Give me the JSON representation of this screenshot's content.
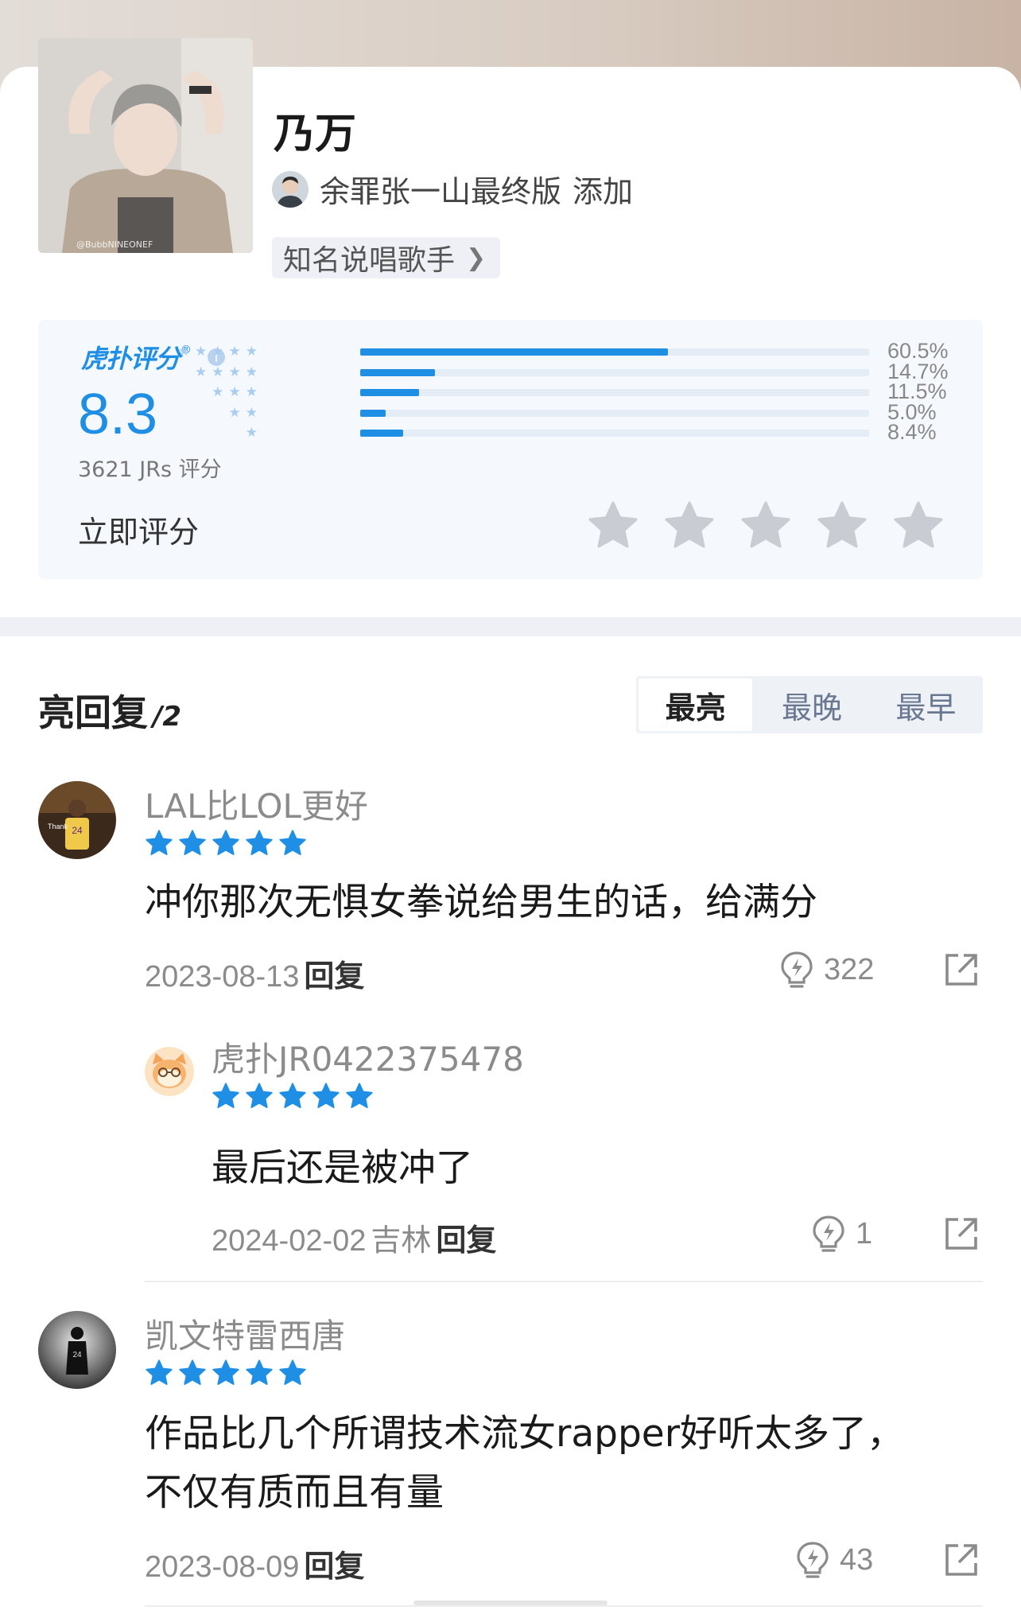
{
  "profile": {
    "name": "乃万",
    "contributor": "余罪张一山最终版",
    "contributor_action": "添加",
    "tag": "知名说唱歌手",
    "photo_watermark": "@BubbNINEONEF"
  },
  "rating": {
    "brand": "虎扑评分",
    "score": "8.3",
    "count_text": "3621 JRs 评分",
    "rate_now_label": "立即评分",
    "distribution": [
      {
        "stars": 5,
        "percent": 60.5,
        "label": "60.5%"
      },
      {
        "stars": 4,
        "percent": 14.7,
        "label": "14.7%"
      },
      {
        "stars": 3,
        "percent": 11.5,
        "label": "11.5%"
      },
      {
        "stars": 2,
        "percent": 5.0,
        "label": "5.0%"
      },
      {
        "stars": 1,
        "percent": 8.4,
        "label": "8.4%"
      }
    ],
    "accent_color": "#1f8fe6"
  },
  "replies_section": {
    "title": "亮回复",
    "count": "/2",
    "sort_tabs": [
      "最亮",
      "最晚",
      "最早"
    ],
    "active_sort": "最亮"
  },
  "comments": [
    {
      "user": "LAL比LOL更好",
      "stars": 5,
      "text": "冲你那次无惧女拳说给男生的话，给满分",
      "date": "2023-08-13",
      "reply_label": "回复",
      "likes": "322",
      "reply": {
        "user": "虎扑JR0422375478",
        "stars": 5,
        "text": "最后还是被冲了",
        "date": "2024-02-02",
        "location": "吉林",
        "reply_label": "回复",
        "likes": "1"
      }
    },
    {
      "user": "凯文特雷西唐",
      "stars": 5,
      "text_lines": [
        "作品比几个所谓技术流女rapper好听太多了，",
        "不仅有质而且有量"
      ],
      "date": "2023-08-09",
      "reply_label": "回复",
      "likes": "43"
    }
  ]
}
